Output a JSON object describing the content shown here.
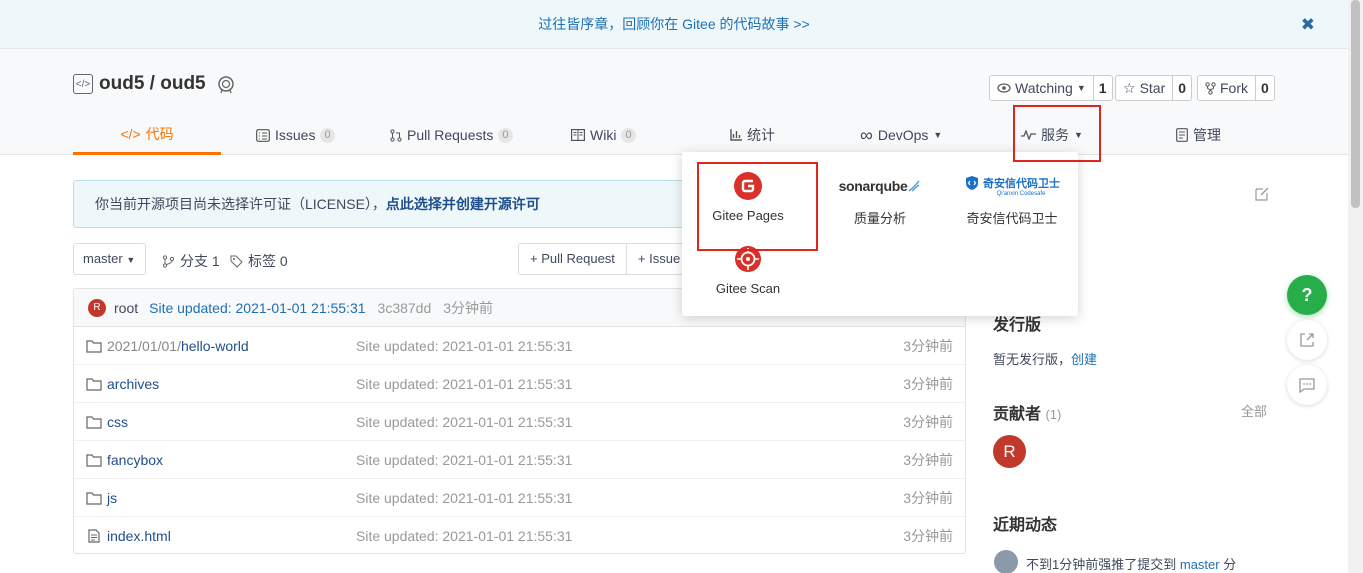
{
  "banner": {
    "text": "过往皆序章，回顾你在 Gitee 的代码故事 >>",
    "close": "✖"
  },
  "repo": {
    "owner": "oud5",
    "separator": " / ",
    "name": "oud5",
    "watch": {
      "label": "Watching",
      "count": "1"
    },
    "star": {
      "label": "Star",
      "count": "0"
    },
    "fork": {
      "label": "Fork",
      "count": "0"
    }
  },
  "tabs": [
    {
      "label": "代码"
    },
    {
      "label": "Issues",
      "count": "0"
    },
    {
      "label": "Pull Requests",
      "count": "0"
    },
    {
      "label": "Wiki",
      "count": "0"
    },
    {
      "label": "统计"
    },
    {
      "label": "DevOps"
    },
    {
      "label": "服务"
    },
    {
      "label": "管理"
    }
  ],
  "license": {
    "prefix": "你当前开源项目尚未选择许可证（LICENSE），",
    "link": "点此选择并创建开源许可"
  },
  "toolbar": {
    "branch": "master",
    "branches": "分支 1",
    "tags": "标签 0",
    "pull_request": "+ Pull Request",
    "issue": "+ Issue"
  },
  "commit": {
    "avatar": "R",
    "author": "root",
    "message": "Site updated: 2021-01-01 21:55:31",
    "sha": "3c387dd",
    "time": "3分钟前"
  },
  "files": [
    {
      "prefix": "2021/01/01/",
      "name": "hello-world",
      "message": "Site updated: 2021-01-01 21:55:31",
      "time": "3分钟前"
    },
    {
      "prefix": "",
      "name": "archives",
      "message": "Site updated: 2021-01-01 21:55:31",
      "time": "3分钟前"
    },
    {
      "prefix": "",
      "name": "css",
      "message": "Site updated: 2021-01-01 21:55:31",
      "time": "3分钟前"
    },
    {
      "prefix": "",
      "name": "fancybox",
      "message": "Site updated: 2021-01-01 21:55:31",
      "time": "3分钟前"
    },
    {
      "prefix": "",
      "name": "js",
      "message": "Site updated: 2021-01-01 21:55:31",
      "time": "3分钟前"
    },
    {
      "prefix": "",
      "name": "index.html",
      "message": "Site updated: 2021-01-01 21:55:31",
      "time": "3分钟前"
    }
  ],
  "services_menu": {
    "items": [
      {
        "label": "Gitee Pages"
      },
      {
        "label": "质量分析",
        "logo": "sonarqube"
      },
      {
        "label": "奇安信代码卫士",
        "logo": "奇安信代码卫士",
        "logo_sub": "Qi'anxin Codesafe"
      },
      {
        "label": "Gitee Scan"
      }
    ]
  },
  "sidebar": {
    "releases_title": "发行版",
    "releases_empty": "暂无发行版，",
    "releases_create": "创建",
    "contributors_title": "贡献者",
    "contributors_count": "(1)",
    "contributors_all": "全部",
    "contributor_avatar": "R",
    "recent_title": "近期动态",
    "recent_text": "不到1分钟前强推了提交到",
    "recent_branch": "master",
    "recent_suffix": "分"
  },
  "float": {
    "help": "?"
  },
  "colors": {
    "accent": "#fe7300",
    "link": "#1f6fb5",
    "highlight": "#e0251f",
    "help": "#27ae4a"
  }
}
